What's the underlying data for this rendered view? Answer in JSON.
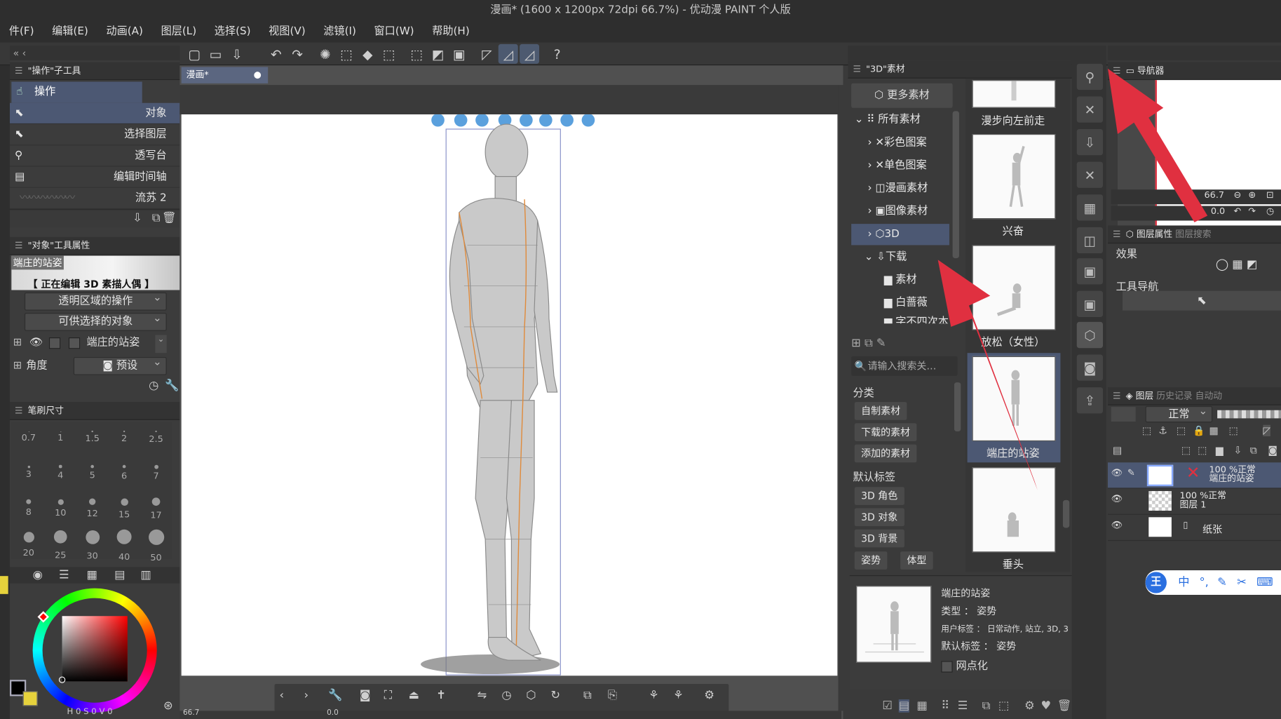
{
  "window": {
    "title": "漫画* (1600 x 1200px 72dpi 66.7%) - 优动漫 PAINT 个人版"
  },
  "menu": [
    "件(F)",
    "编辑(E)",
    "动画(A)",
    "图层(L)",
    "选择(S)",
    "视图(V)",
    "滤镜(I)",
    "窗口(W)",
    "帮助(H)"
  ],
  "subtool_panel": {
    "title": "\"操作\"子工具",
    "group": "操作",
    "items": [
      "对象",
      "选择图层",
      "透写台",
      "编辑时间轴",
      "流苏 2"
    ]
  },
  "tool_property": {
    "title": "\"对象\"工具属性",
    "preview_label": "端庄的站姿",
    "editing_label": "【 正在编辑 3D 素描人偶 】",
    "transparent_op": "透明区域的操作",
    "selectable": "可供选择的对象",
    "model_name": "端庄的站姿",
    "angle_label": "角度",
    "preset_label": "预设"
  },
  "brush_size": {
    "title": "笔刷尺寸",
    "sizes": [
      "0.7",
      "1",
      "1.5",
      "2",
      "2.5",
      "3",
      "4",
      "5",
      "6",
      "7",
      "8",
      "10",
      "12",
      "15",
      "17",
      "20",
      "25",
      "30",
      "40",
      "50"
    ]
  },
  "color_panel": {
    "h_label": "H",
    "h_value": "0",
    "s_label": "S",
    "v_label": "V",
    "s_value": "0",
    "v_value": "0"
  },
  "canvas": {
    "tab": "漫画*",
    "zoom": "66.7",
    "angle": "0.0",
    "background": "#ffffff"
  },
  "material_panel": {
    "title": "\"3D\"素材",
    "more_btn": "更多素材",
    "tree": [
      {
        "label": "所有素材"
      },
      {
        "label": "彩色图案"
      },
      {
        "label": "单色图案"
      },
      {
        "label": "漫画素材"
      },
      {
        "label": "图像素材"
      },
      {
        "label": "3D"
      },
      {
        "label": "下载"
      },
      {
        "label": "素材"
      },
      {
        "label": "白蔷薇"
      },
      {
        "label": "字不四次本"
      }
    ],
    "search_placeholder": "请输入搜索关…",
    "categories_title": "分类",
    "categories": [
      "自制素材",
      "下载的素材",
      "添加的素材"
    ],
    "default_tags_title": "默认标签",
    "tags": [
      "3D 角色",
      "3D 对象",
      "3D 背景",
      "姿势",
      "体型"
    ],
    "thumbs": [
      "漫步向左前走",
      "兴奋",
      "放松（女性）",
      "端庄的站姿",
      "垂头"
    ],
    "detail": {
      "name": "端庄的站姿",
      "type": "类型 ： 姿势",
      "user_tags": "用户标签 ： 日常动作, 站立, 3D, 3",
      "default_tags": "默认标签 ： 姿势",
      "halftone": "网点化"
    }
  },
  "navigator": {
    "tab": "导航器",
    "zoom": "66.7",
    "angle": "0.0"
  },
  "layer_property": {
    "tab": "图层属性",
    "tab2": "图层搜索",
    "effect": "效果",
    "tool_nav": "工具导航"
  },
  "layers_panel": {
    "tab": "图层",
    "tab2": "历史记录",
    "tab3": "自动动",
    "blend": "正常",
    "layers": [
      {
        "mode": "100 %正常",
        "name": "端庄的站姿"
      },
      {
        "mode": "100 %正常",
        "name": "图层 1"
      },
      {
        "mode": "",
        "name": "纸张"
      }
    ]
  },
  "ime": {
    "label": "中"
  },
  "colors": {
    "accent": "#4c5873",
    "arrow": "#e03040"
  }
}
